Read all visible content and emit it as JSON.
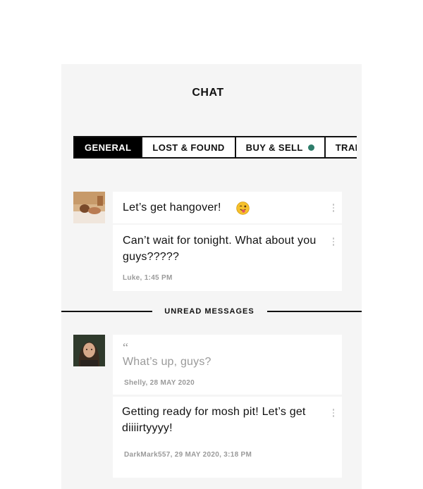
{
  "chat": {
    "title": "CHAT",
    "tabs": [
      {
        "label": "GENERAL",
        "active": true
      },
      {
        "label": "LOST & FOUND",
        "active": false
      },
      {
        "label": "BUY & SELL",
        "active": false,
        "indicator_color": "#2e7d6b"
      },
      {
        "label": "TRANSPORTATION",
        "active": false
      }
    ],
    "messages_before": [
      {
        "text": "Let’s get hangover!",
        "emoji": "winking-tongue-emoji"
      },
      {
        "text": "Can’t wait for tonight. What about you guys?????",
        "meta": "Luke, 1:45 PM"
      }
    ],
    "divider": {
      "label": "UNREAD MESSAGES"
    },
    "messages_after": [
      {
        "quote_mark": "“",
        "text": "What’s up, guys?",
        "meta": "Shelly, 28 MAY 2020"
      },
      {
        "text": "Getting ready for mosh pit! Let’s get diiiirtyyyy!",
        "meta": "DarkMark557, 29 MAY 2020, 3:18 PM"
      }
    ]
  },
  "colors": {
    "panel_bg": "#f5f5f5",
    "accent_dot": "#2e7d6b",
    "meta_text": "#9a9a9a"
  }
}
